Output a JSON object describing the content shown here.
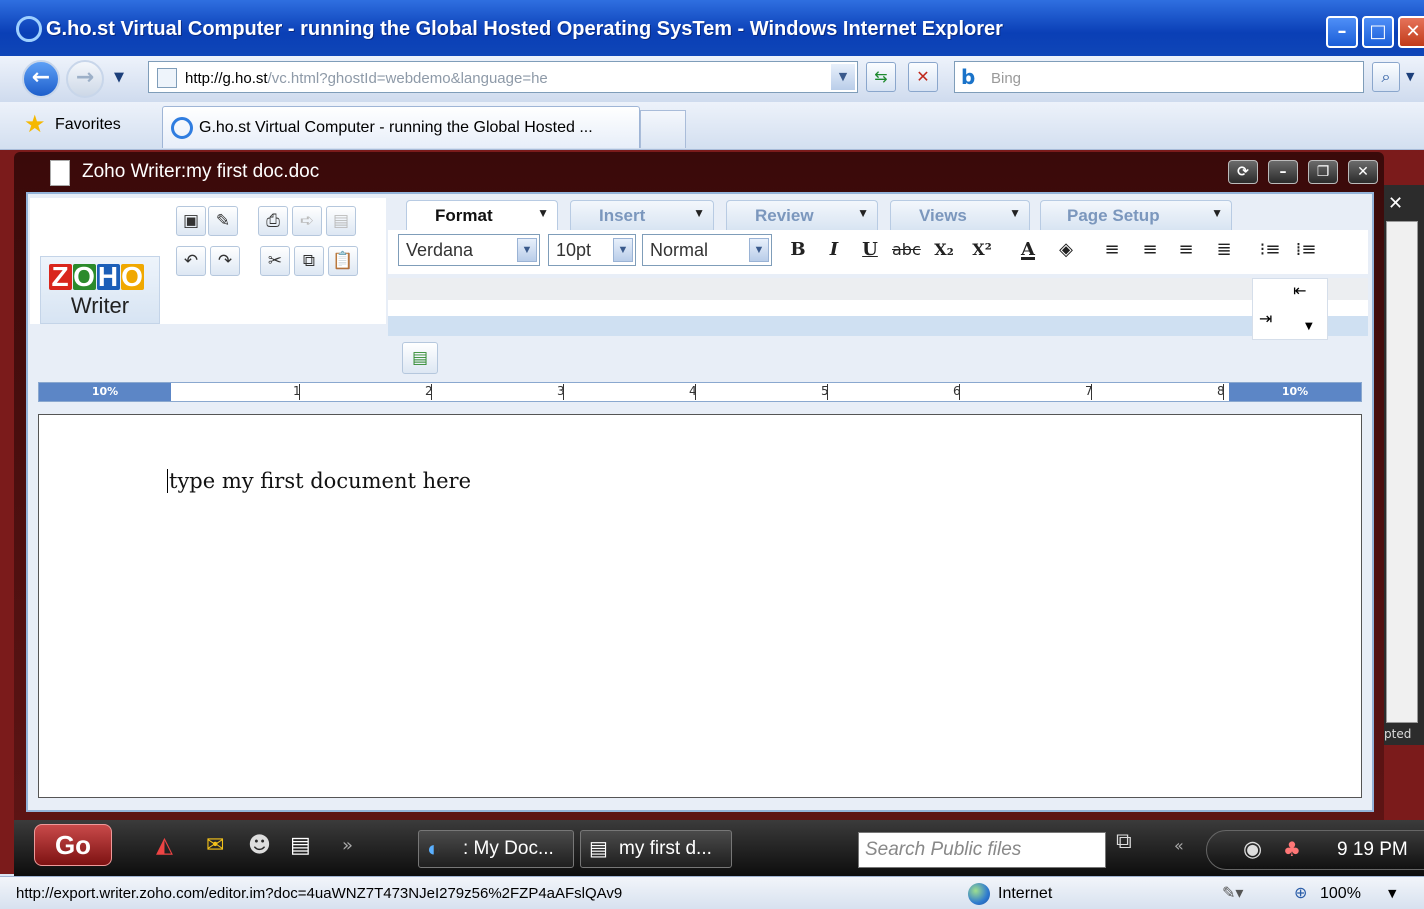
{
  "browser": {
    "title": "G.ho.st Virtual Computer - running the Global Hosted Operating SysTem - Windows Internet Explorer",
    "url_domain": "http://g.ho.st",
    "url_rest": "/vc.html?ghostId=webdemo&language=he",
    "search_placeholder": "Bing",
    "favorites_label": "Favorites",
    "tab_title": "G.ho.st Virtual Computer - running the Global Hosted ..."
  },
  "writer": {
    "window_title": "Zoho Writer:my first doc.doc",
    "logo_letters": [
      "Z",
      "O",
      "H",
      "O"
    ],
    "logo_product": "Writer",
    "tabs": [
      "Format",
      "Insert",
      "Review",
      "Views",
      "Page Setup"
    ],
    "font": "Verdana",
    "size": "10pt",
    "style": "Normal",
    "ruler": {
      "left_margin": "10%",
      "right_margin": "10%",
      "ticks": [
        "1",
        "2",
        "3",
        "4",
        "5",
        "6",
        "7",
        "8"
      ]
    },
    "document_text": "type my first document here"
  },
  "side_panel_label": "pted",
  "taskbar": {
    "go": "Go",
    "task1": ": My Doc...",
    "task2": "my first d...",
    "search_placeholder": "Search  Public files",
    "clock": "9   19  PM"
  },
  "statusbar": {
    "url": "http://export.writer.zoho.com/editor.im?doc=4uaWNZ7T473NJeI279z56%2FZP4aAFslQAv9",
    "zone": "Internet",
    "zoom": "100%"
  },
  "colors": {
    "ie_title": "#0a3fb6",
    "writer_frame": "#5d1414",
    "ruler_margin": "#5c86c6",
    "logo": [
      "#d9261c",
      "#2b8a2b",
      "#1c5fb8",
      "#f0a800"
    ]
  },
  "icons": [
    "ie-logo-icon",
    "back-icon",
    "forward-icon",
    "refresh-icon",
    "stop-icon",
    "search-icon",
    "star-icon",
    "save-icon",
    "print-icon",
    "undo-icon",
    "redo-icon",
    "cut-icon",
    "copy-icon",
    "paste-icon",
    "bold-icon",
    "italic-icon",
    "underline-icon",
    "align-left-icon",
    "numbered-list-icon",
    "bullet-list-icon",
    "globe-icon"
  ]
}
